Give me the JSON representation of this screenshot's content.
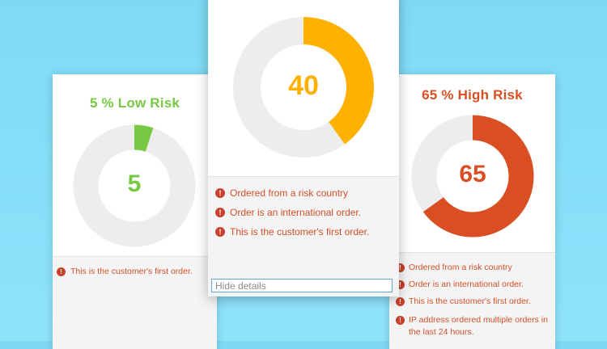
{
  "colors": {
    "low": "#77c943",
    "medium": "#ffb100",
    "high": "#d94f23",
    "track": "#ededed",
    "reason_text": "#d24f2a"
  },
  "low_card": {
    "title": "5 % Low Risk",
    "score": "5",
    "level_percent": 5,
    "reasons": [
      "This is the customer's first order."
    ]
  },
  "medium_card": {
    "score": "40",
    "level_percent": 40,
    "reasons": [
      "Ordered from a risk country",
      "Order is an international order.",
      "This is the customer's first order."
    ],
    "hide_details_label": "Hide details"
  },
  "high_card": {
    "title": "65 % High Risk",
    "score": "65",
    "level_percent": 65,
    "reasons": [
      "Ordered from a risk country",
      "Order is an international order.",
      "This is the customer's first order.",
      "IP address ordered multiple orders in the last 24 hours."
    ]
  },
  "icons": {
    "warning": "exclamation-circle-icon"
  },
  "warning_glyph": "!"
}
